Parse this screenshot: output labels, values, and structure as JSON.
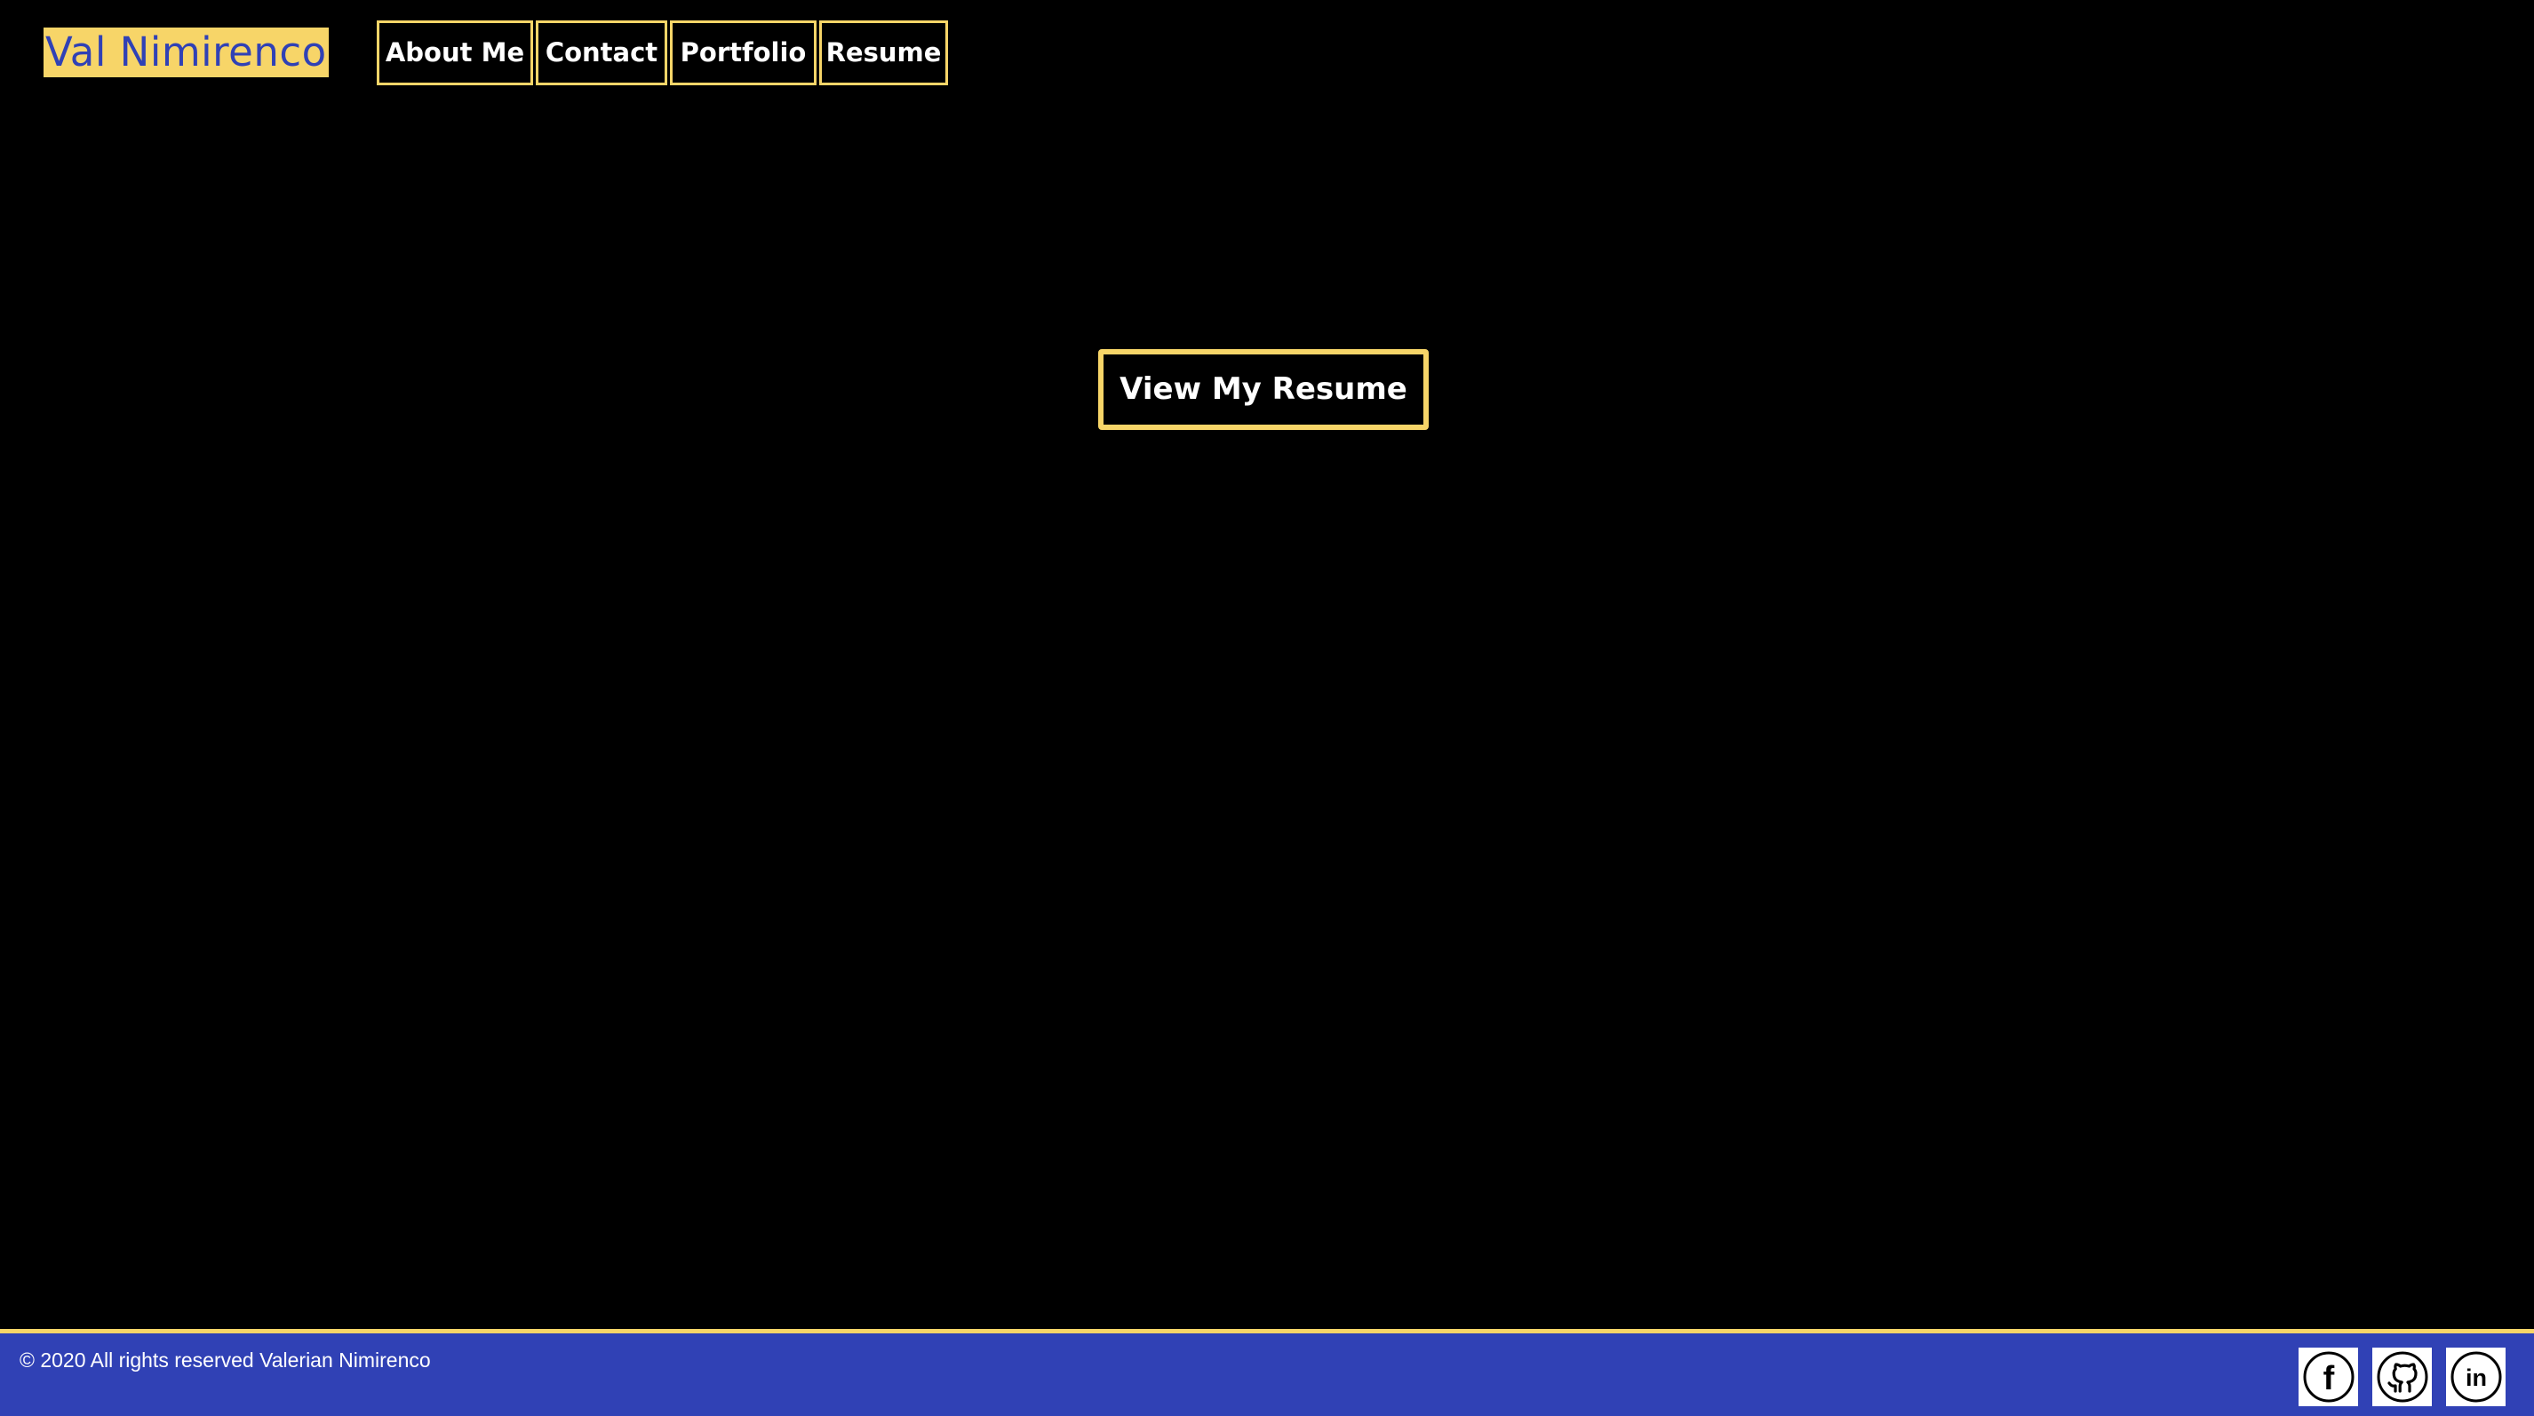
{
  "header": {
    "brand": "Val Nimirenco",
    "nav": [
      {
        "label": "About Me"
      },
      {
        "label": "Contact"
      },
      {
        "label": "Portfolio"
      },
      {
        "label": "Resume"
      }
    ]
  },
  "main": {
    "cta_label": "View My Resume"
  },
  "footer": {
    "copyright": "© 2020 All rights reserved Valerian Nimirenco",
    "social": [
      {
        "icon": "facebook-icon",
        "glyph": "f"
      },
      {
        "icon": "github-icon"
      },
      {
        "icon": "linkedin-icon",
        "glyph": "in"
      }
    ]
  },
  "colors": {
    "background": "#000000",
    "accent_yellow": "#f7d568",
    "brand_blue": "#3041b5",
    "text": "#ffffff"
  }
}
